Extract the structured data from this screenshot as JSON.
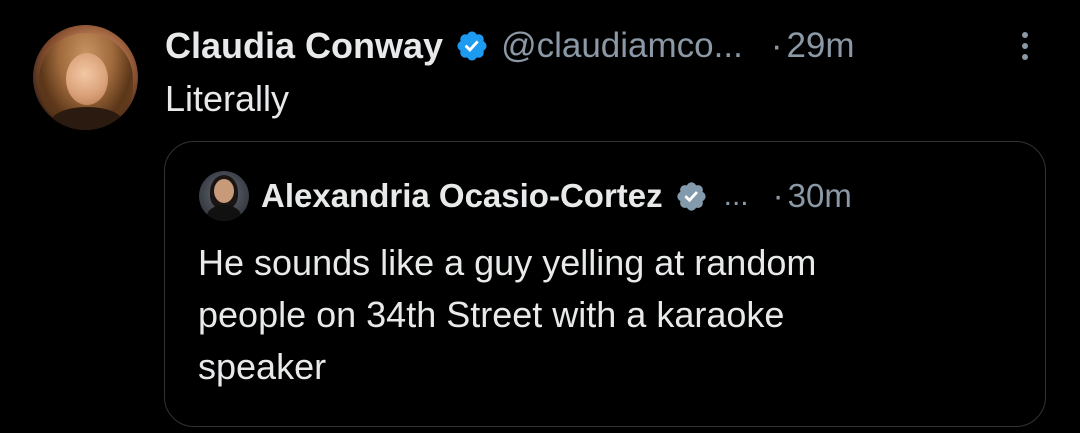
{
  "colors": {
    "background": "#000000",
    "text_primary": "#e7e9ea",
    "text_secondary": "#8b98a5",
    "verified_blue": "#1d9bf0",
    "verified_gray": "#829aab",
    "border": "#2f3336"
  },
  "tweet": {
    "author_name": "Claudia Conway",
    "handle": "@claudiamco...",
    "separator": "·",
    "time": "29m",
    "text": "Literally",
    "avatar_icon": "profile-avatar",
    "verified_icon": "verified-badge-blue",
    "more_icon": "more-vertical-icon"
  },
  "quoted_tweet": {
    "author_name": "Alexandria Ocasio-Cortez",
    "handle_truncated": "...",
    "separator": "·",
    "time": "30m",
    "text_lines": [
      "He sounds like a guy yelling at random",
      "people on 34th Street with a karaoke",
      "speaker"
    ],
    "avatar_icon": "profile-avatar",
    "verified_icon": "verified-badge-gray"
  }
}
